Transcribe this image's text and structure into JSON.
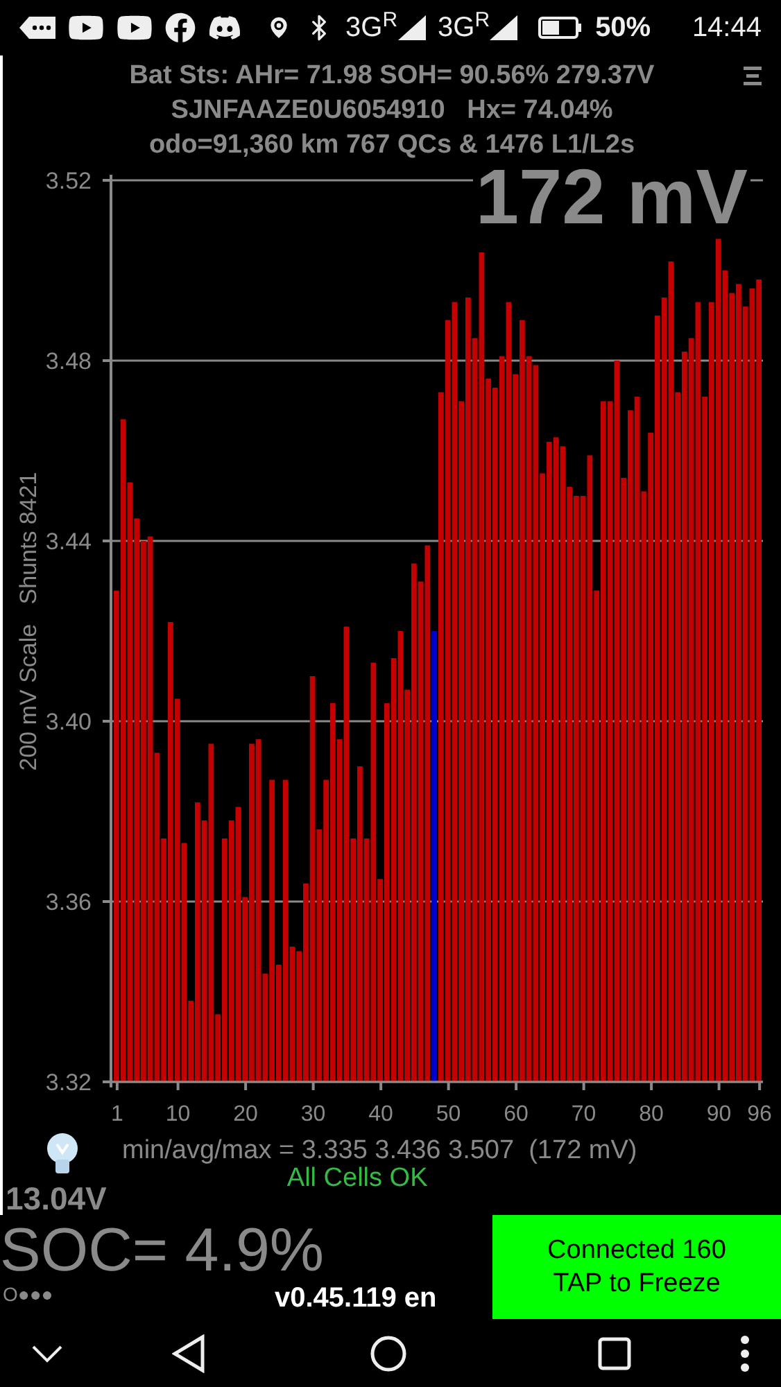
{
  "status_bar": {
    "networks": [
      "3G$^{R}$",
      "3G$^{R}$"
    ],
    "battery": "50%",
    "time": "14:44"
  },
  "header": {
    "lines": [
      "Bat Sts: AHr= 71.98 SOH= 90.56% 279.37V",
      "SJNFAAZE0U6054910   Hx= 74.04%",
      "odo=91,360 km 767 QCs & 1476 L1/L2s"
    ]
  },
  "chart": {
    "spread_readout": "172 mV",
    "chart_data": {
      "type": "bar",
      "ylabel": "200 mV Scale   Shunts 8421",
      "stacked": true,
      "grid": true,
      "xlim": [
        0.5,
        96.5
      ],
      "x": [
        1,
        2,
        3,
        4,
        5,
        6,
        7,
        8,
        9,
        10,
        11,
        12,
        13,
        14,
        15,
        16,
        17,
        18,
        19,
        20,
        21,
        22,
        23,
        24,
        25,
        26,
        27,
        28,
        29,
        30,
        31,
        32,
        33,
        34,
        35,
        36,
        37,
        38,
        39,
        40,
        41,
        42,
        43,
        44,
        45,
        46,
        47,
        48,
        49,
        50,
        51,
        52,
        53,
        54,
        55,
        56,
        57,
        58,
        59,
        60,
        61,
        62,
        63,
        64,
        65,
        66,
        67,
        68,
        69,
        70,
        71,
        72,
        73,
        74,
        75,
        76,
        77,
        78,
        79,
        80,
        81,
        82,
        83,
        84,
        85,
        86,
        87,
        88,
        89,
        90,
        91,
        92,
        93,
        94,
        95,
        96
      ],
      "series": [
        {
          "color": "#c40000",
          "values": [
            3.429,
            3.467,
            3.453,
            3.445,
            3.44,
            3.441,
            3.393,
            3.374,
            3.422,
            3.405,
            3.373,
            3.338,
            3.382,
            3.378,
            3.395,
            3.335,
            3.374,
            3.378,
            3.381,
            3.361,
            3.395,
            3.396,
            3.344,
            3.387,
            3.346,
            3.387,
            3.35,
            3.349,
            3.364,
            3.41,
            3.376,
            3.387,
            3.404,
            3.396,
            3.421,
            3.374,
            3.39,
            3.374,
            3.413,
            3.365,
            3.404,
            3.414,
            3.42,
            3.407,
            3.435,
            3.431,
            3.439,
            null,
            3.473,
            3.489,
            3.493,
            3.471,
            3.494,
            3.485,
            3.504,
            3.476,
            3.474,
            3.481,
            3.493,
            3.477,
            3.489,
            3.481,
            3.479,
            3.455,
            3.462,
            3.463,
            3.461,
            3.452,
            3.45,
            3.45,
            3.459,
            3.429,
            3.471,
            3.471,
            3.48,
            3.454,
            3.469,
            3.472,
            3.451,
            3.464,
            3.49,
            3.494,
            3.502,
            3.473,
            3.482,
            3.485,
            3.493,
            3.472,
            3.493,
            3.507,
            3.5,
            3.495,
            3.497,
            3.492,
            3.496,
            3.498
          ]
        },
        {
          "color": "#0000d0",
          "values": [
            null,
            null,
            null,
            null,
            null,
            null,
            null,
            null,
            null,
            null,
            null,
            null,
            null,
            null,
            null,
            null,
            null,
            null,
            null,
            null,
            null,
            null,
            null,
            null,
            null,
            null,
            null,
            null,
            null,
            null,
            null,
            null,
            null,
            null,
            null,
            null,
            null,
            null,
            null,
            null,
            null,
            null,
            null,
            null,
            null,
            null,
            null,
            3.42,
            null,
            null,
            null,
            null,
            null,
            null,
            null,
            null,
            null,
            null,
            null,
            null,
            null,
            null,
            null,
            null,
            null,
            null,
            null,
            null,
            null,
            null,
            null,
            null,
            null,
            null,
            null,
            null,
            null,
            null,
            null,
            null,
            null,
            null,
            null,
            null,
            null,
            null,
            null,
            null,
            null,
            null,
            null,
            null,
            null,
            null,
            null,
            null
          ]
        }
      ],
      "ylim": [
        3.32,
        3.52
      ],
      "yticks": [
        {
          "value": 3.32,
          "label": "3.32"
        },
        {
          "value": 3.36,
          "label": "3.36"
        },
        {
          "value": 3.4,
          "label": "3.40"
        },
        {
          "value": 3.44,
          "label": "3.44"
        },
        {
          "value": 3.48,
          "label": "3.48"
        },
        {
          "value": 3.52,
          "label": "3.52"
        }
      ],
      "xticks": [
        1,
        10,
        20,
        30,
        40,
        50,
        60,
        70,
        80,
        90,
        96
      ]
    }
  },
  "summary": "min/avg/max = 3.335 3.436 3.507  (172 mV)",
  "status_message": "All Cells OK",
  "aux_voltage": "13.04V",
  "soc": "SOC= 4.9%",
  "indicator": "O●●●",
  "version": "v0.45.119 en",
  "connect_button": {
    "lines": [
      "Connected 160",
      "TAP to Freeze"
    ]
  }
}
